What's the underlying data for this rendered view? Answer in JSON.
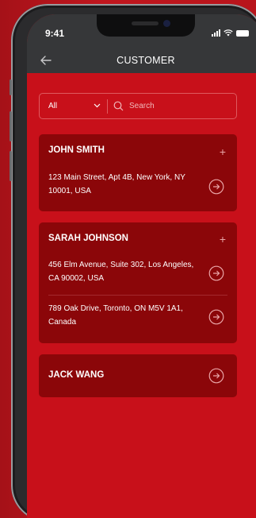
{
  "status_bar": {
    "time": "9:41"
  },
  "header": {
    "title": "CUSTOMER"
  },
  "filter": {
    "selected": "All",
    "search_placeholder": "Search"
  },
  "customers": [
    {
      "name": "JOHN SMITH",
      "addresses": [
        "123 Main Street, Apt 4B, New York, NY 10001, USA"
      ]
    },
    {
      "name": "SARAH JOHNSON",
      "addresses": [
        "456 Elm Avenue, Suite 302, Los Angeles, CA 90002, USA",
        "789 Oak Drive, Toronto, ON M5V 1A1, Canada"
      ]
    },
    {
      "name": "JACK WANG",
      "addresses": []
    }
  ],
  "colors": {
    "screen_bg": "#c8101a",
    "card_bg": "#8b0609",
    "header_bg": "#363739",
    "outer_bg": "#b8141b"
  },
  "icons": {
    "back": "arrow-left-icon",
    "dropdown": "chevron-down-icon",
    "search": "search-icon",
    "add": "plus-icon",
    "open": "circle-arrow-right-icon"
  }
}
